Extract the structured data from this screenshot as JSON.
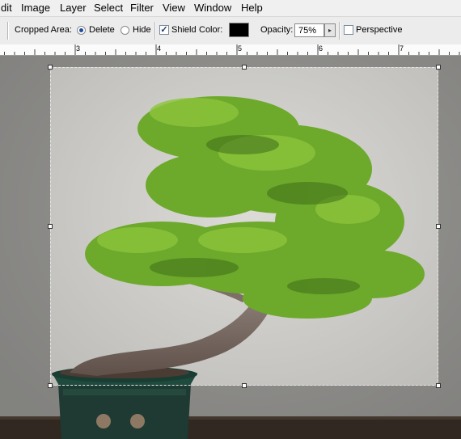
{
  "menubar": {
    "items": [
      "dit",
      "Image",
      "Layer",
      "Select",
      "Filter",
      "View",
      "Window",
      "Help"
    ]
  },
  "options": {
    "cropped_area_label": "Cropped Area:",
    "delete_label": "Delete",
    "hide_label": "Hide",
    "shield_label": "Shield",
    "color_label": "Color:",
    "shield_color": "#000000",
    "opacity_label": "Opacity:",
    "opacity_value": "75%",
    "perspective_label": "Perspective",
    "delete_selected": true,
    "hide_selected": false,
    "shield_checked": true,
    "perspective_checked": false
  },
  "ruler": {
    "ticks": [
      "3",
      "4",
      "5",
      "6",
      "7"
    ]
  },
  "colors": {
    "wall": "#d8d7d3",
    "foliage": "#6da92b",
    "trunk": "#7d6f66",
    "pot": "#1f4a3e"
  }
}
